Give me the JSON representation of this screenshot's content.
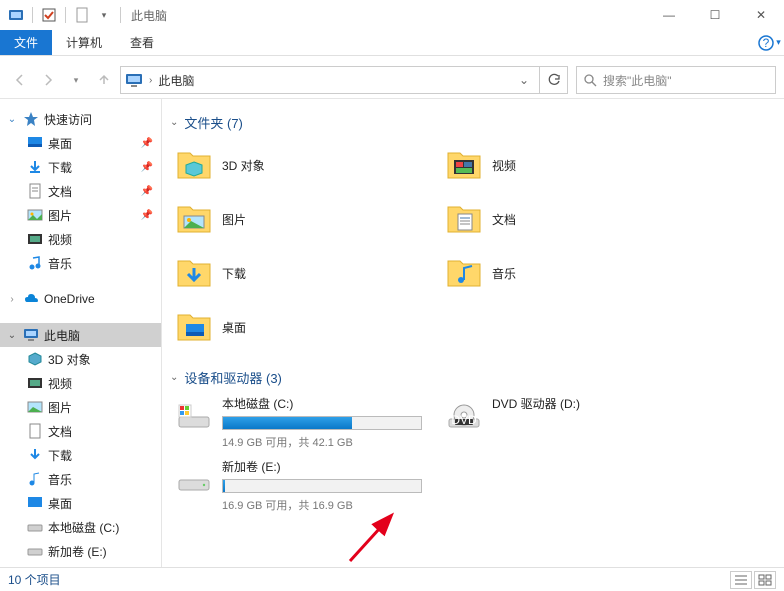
{
  "window": {
    "title": "此电脑",
    "min": "—",
    "max": "☐",
    "close": "✕"
  },
  "ribbon": {
    "file": "文件",
    "computer": "计算机",
    "view": "查看"
  },
  "nav": {
    "breadcrumb": "此电脑",
    "search_placeholder": "搜索\"此电脑\""
  },
  "sidebar": {
    "quick": "快速访问",
    "quick_items": [
      {
        "label": "桌面",
        "pin": true
      },
      {
        "label": "下载",
        "pin": true
      },
      {
        "label": "文档",
        "pin": true
      },
      {
        "label": "图片",
        "pin": true
      },
      {
        "label": "视频",
        "pin": false
      },
      {
        "label": "音乐",
        "pin": false
      }
    ],
    "onedrive": "OneDrive",
    "thispc": "此电脑",
    "pc_items": [
      {
        "label": "3D 对象"
      },
      {
        "label": "视频"
      },
      {
        "label": "图片"
      },
      {
        "label": "文档"
      },
      {
        "label": "下载"
      },
      {
        "label": "音乐"
      },
      {
        "label": "桌面"
      },
      {
        "label": "本地磁盘 (C:)"
      },
      {
        "label": "新加卷 (E:)"
      }
    ]
  },
  "content": {
    "folders_header": "文件夹 (7)",
    "folders": [
      {
        "label": "3D 对象"
      },
      {
        "label": "视频"
      },
      {
        "label": "图片"
      },
      {
        "label": "文档"
      },
      {
        "label": "下载"
      },
      {
        "label": "音乐"
      },
      {
        "label": "桌面"
      }
    ],
    "drives_header": "设备和驱动器 (3)",
    "drives": [
      {
        "name": "本地磁盘 (C:)",
        "status": "14.9 GB 可用，共 42.1 GB",
        "fill_pct": 65
      },
      {
        "name": "DVD 驱动器 (D:)",
        "status": "",
        "fill_pct": null
      },
      {
        "name": "新加卷 (E:)",
        "status": "16.9 GB 可用，共 16.9 GB",
        "fill_pct": 1
      }
    ]
  },
  "status": {
    "count": "10 个项目"
  }
}
